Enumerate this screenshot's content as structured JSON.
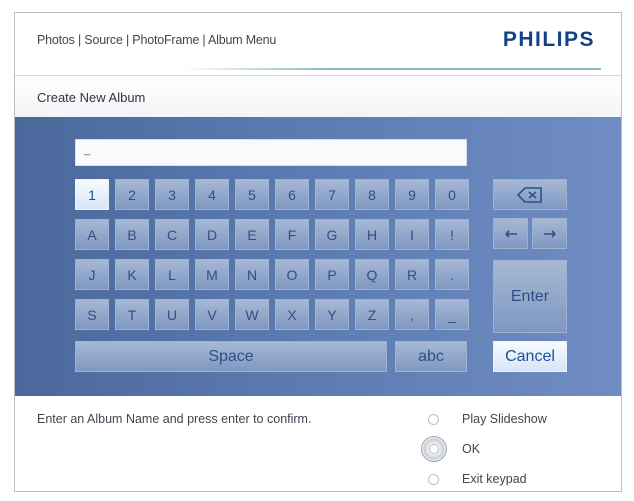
{
  "header": {
    "breadcrumb": "Photos | Source | PhotoFrame | Album Menu",
    "brand": "PHILIPS"
  },
  "page_title": "Create New Album",
  "text_entry": {
    "value": "_"
  },
  "keyboard": {
    "row1": [
      "1",
      "2",
      "3",
      "4",
      "5",
      "6",
      "7",
      "8",
      "9",
      "0"
    ],
    "row2": [
      "A",
      "B",
      "C",
      "D",
      "E",
      "F",
      "G",
      "H",
      "I",
      "!"
    ],
    "row3": [
      "J",
      "K",
      "L",
      "M",
      "N",
      "O",
      "P",
      "Q",
      "R",
      "."
    ],
    "row4": [
      "S",
      "T",
      "U",
      "V",
      "W",
      "X",
      "Y",
      "Z",
      ",",
      "_"
    ],
    "selected_key": "1",
    "space_label": "Space",
    "abc_label": "abc",
    "enter_label": "Enter",
    "cancel_label": "Cancel",
    "backspace_icon": "backspace-icon",
    "left_icon": "arrow-left-icon",
    "right_icon": "arrow-right-icon"
  },
  "footer": {
    "instruction": "Enter an Album Name and press enter to confirm.",
    "options": [
      "Play Slideshow",
      "OK",
      "Exit keypad"
    ]
  },
  "colors": {
    "brand": "#15418a",
    "panel": "#5b7ab0",
    "key": "#8ea5cb",
    "key_text": "#2e4f86"
  }
}
